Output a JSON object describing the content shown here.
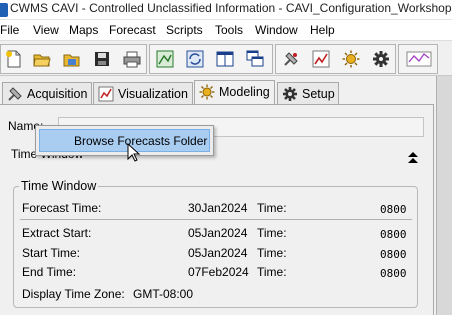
{
  "window": {
    "title": "CWMS CAVI - Controlled Unclassified Information - CAVI_Configuration_Workshop"
  },
  "menu": [
    "File",
    "View",
    "Maps",
    "Forecast",
    "Scripts",
    "Tools",
    "Window",
    "Help"
  ],
  "toolbar": {
    "icons": [
      "new-file-icon",
      "open-folder-icon",
      "open-folder-alt-icon",
      "save-icon",
      "print-icon",
      "network-map-icon",
      "map-refresh-icon",
      "window-layout-icon",
      "cascade-windows-icon",
      "acquisition-tool-icon",
      "visualization-tool-icon",
      "modeling-tool-icon",
      "setup-gear-icon",
      "chart-icon"
    ]
  },
  "tabs": [
    {
      "label": "Acquisition",
      "icon": "satellite-icon",
      "active": false
    },
    {
      "label": "Visualization",
      "icon": "chart-graph-icon",
      "active": false
    },
    {
      "label": "Modeling",
      "icon": "sun-model-icon",
      "active": true
    },
    {
      "label": "Setup",
      "icon": "gear-icon",
      "active": false
    }
  ],
  "form": {
    "name_label": "Name:",
    "name_value": "",
    "time_window_header": "Time Window"
  },
  "time_window": {
    "legend": "Time Window",
    "time_label": "Time:",
    "rows": [
      {
        "label": "Forecast Time:",
        "date": "30Jan2024",
        "time": "0800"
      },
      {
        "label": "Extract Start:",
        "date": "05Jan2024",
        "time": "0800"
      },
      {
        "label": "Start Time:",
        "date": "05Jan2024",
        "time": "0800"
      },
      {
        "label": "End Time:",
        "date": "07Feb2024",
        "time": "0800"
      }
    ],
    "timezone_label": "Display Time Zone:",
    "timezone_value": "GMT-08:00"
  },
  "popup": {
    "item": "Browse Forecasts Folder"
  },
  "colors": {
    "popup_highlight": "#a9cdf1",
    "panel_bg": "#f0f0f0"
  }
}
